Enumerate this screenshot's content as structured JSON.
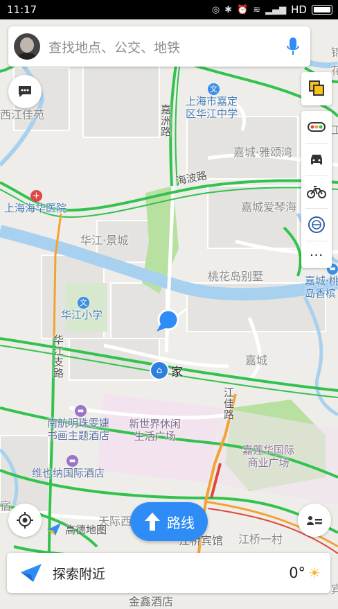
{
  "status_bar": {
    "time": "11:17",
    "network": "HD",
    "icons": [
      "sync-icon",
      "bluetooth-icon",
      "alarm-icon",
      "wifi-icon",
      "signal-icon",
      "battery-icon"
    ]
  },
  "search": {
    "placeholder": "查找地点、公交、地铁"
  },
  "map": {
    "area_labels": [
      "西江佳苑",
      "华江·景城",
      "嘉城·雅颂湾",
      "嘉城爱琴海",
      "桃花岛别墅",
      "嘉城",
      "天际西",
      "江桥一村"
    ],
    "roads": [
      "嘉洲路",
      "海波路",
      "华江支路",
      "江佳路"
    ],
    "pois": [
      {
        "name": "上海市嘉定\n区华江中学",
        "icon": "school-icon"
      },
      {
        "name": "上海海华医院",
        "icon": "hospital-icon"
      },
      {
        "name": "华江小学",
        "icon": "school-icon"
      },
      {
        "name": "南航明珠雯婕\n书画主题酒店",
        "icon": "hotel-icon"
      },
      {
        "name": "维也纳国际酒店",
        "icon": "hotel-icon"
      },
      {
        "name": "新世界休闲\n生活广场",
        "icon": ""
      },
      {
        "name": "嘉莲华国际\n商业广场",
        "icon": ""
      },
      {
        "name": "嘉城·桃\n岛香槟",
        "icon": "hotel-icon"
      },
      {
        "name": "江桥宾馆",
        "icon": ""
      },
      {
        "name": "金鑫酒店",
        "icon": ""
      }
    ],
    "home_label": "家",
    "edge_labels": [
      "锦",
      "花",
      "工",
      "宿",
      "宾"
    ],
    "brand": "高德地图"
  },
  "colors": {
    "road_green": "#32c24d",
    "road_yellow": "#f3a233",
    "road_red": "#e0483a",
    "river": "#a8d1f0",
    "park": "#b8e0a0",
    "accent": "#2f8cf7"
  },
  "route_button": {
    "label": "路线"
  },
  "bottom": {
    "label": "探索附近",
    "temperature": "0°"
  }
}
